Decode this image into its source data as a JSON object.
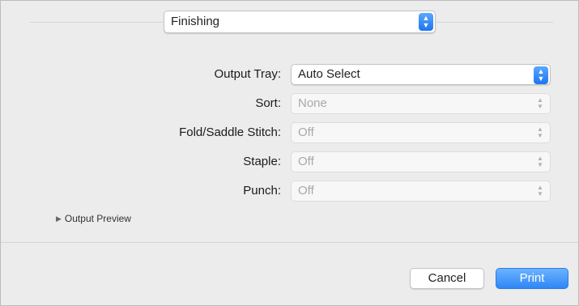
{
  "header": {
    "section_popup_value": "Finishing"
  },
  "form": {
    "fields": [
      {
        "label": "Output Tray:",
        "value": "Auto Select",
        "enabled": true
      },
      {
        "label": "Sort:",
        "value": "None",
        "enabled": false
      },
      {
        "label": "Fold/Saddle Stitch:",
        "value": "Off",
        "enabled": false
      },
      {
        "label": "Staple:",
        "value": "Off",
        "enabled": false
      },
      {
        "label": "Punch:",
        "value": "Off",
        "enabled": false
      }
    ]
  },
  "disclosure": {
    "label": "Output Preview",
    "icon": "disclosure-triangle-right-icon"
  },
  "footer": {
    "cancel_label": "Cancel",
    "print_label": "Print"
  },
  "colors": {
    "accent": "#2f86f5",
    "disabled_text": "#a8a8a8"
  }
}
